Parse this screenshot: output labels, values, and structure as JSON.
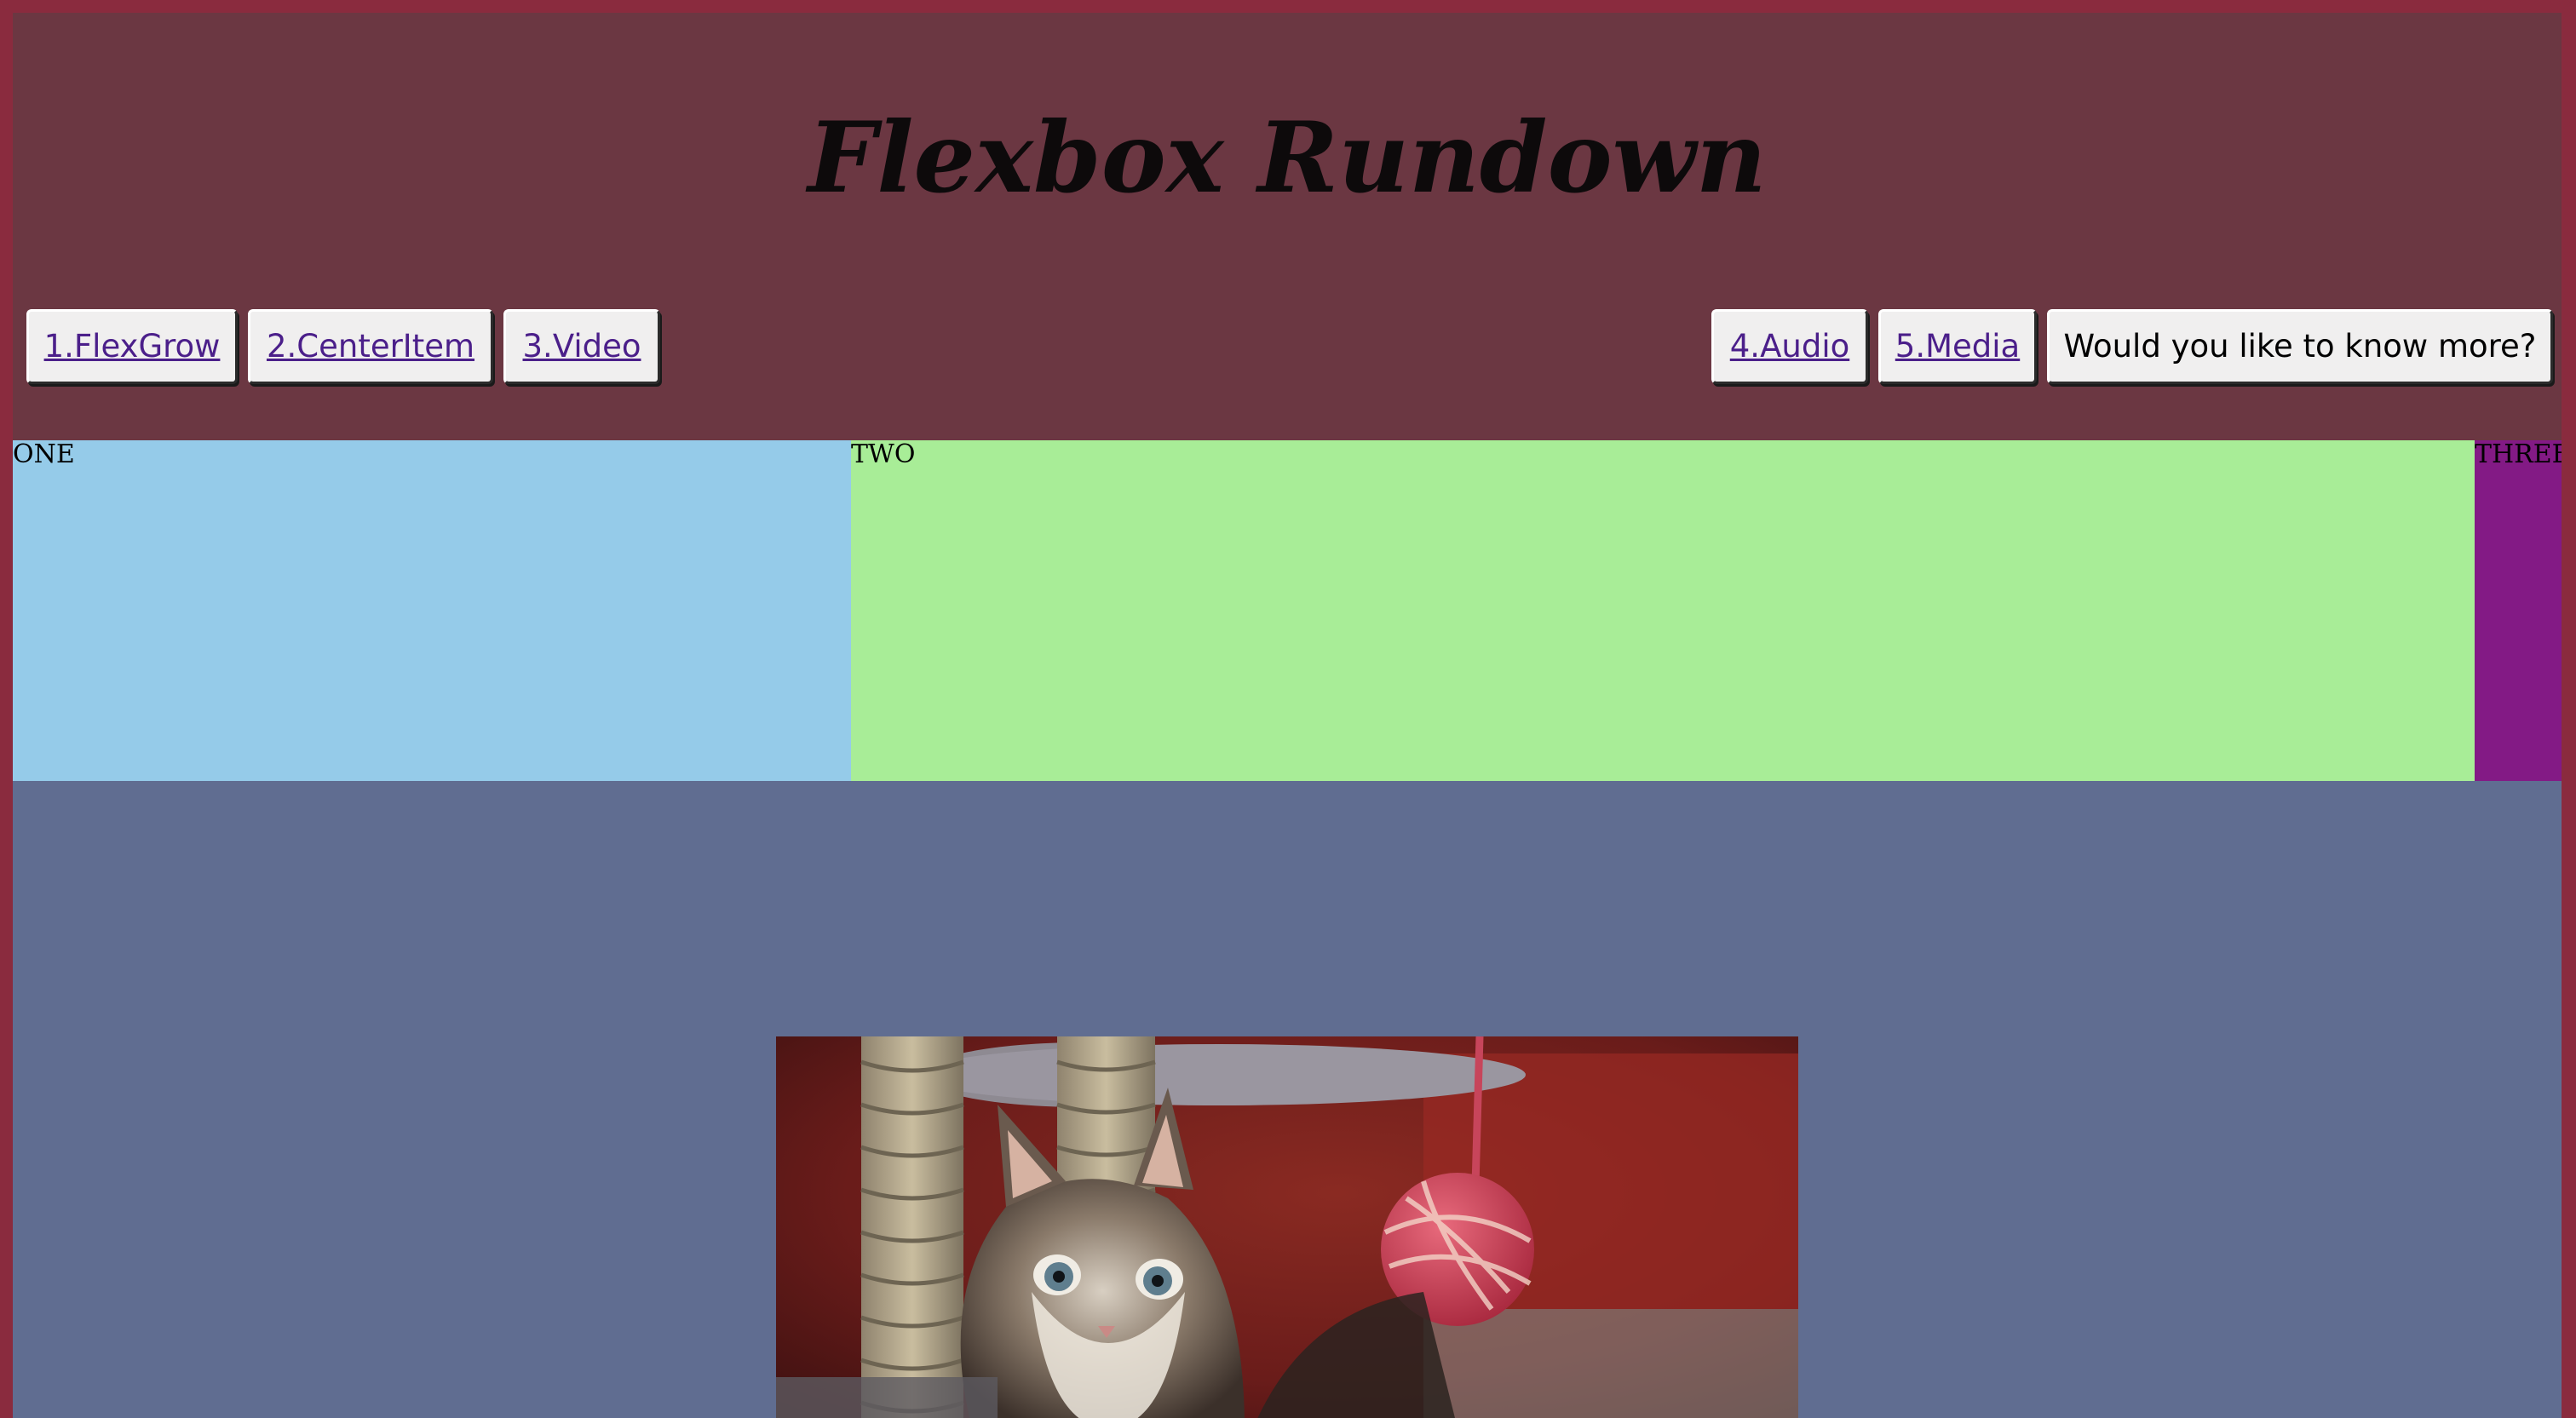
{
  "header": {
    "title": "Flexbox Rundown"
  },
  "nav": {
    "left": [
      {
        "label": "1.FlexGrow"
      },
      {
        "label": "2.CenterItem"
      },
      {
        "label": "3.Video"
      }
    ],
    "right": [
      {
        "label": "4.Audio"
      },
      {
        "label": "5.Media"
      }
    ],
    "more_button": "Would you like to know more?"
  },
  "flex_boxes": {
    "one": "ONE",
    "two": "TWO",
    "three": "THREE"
  },
  "colors": {
    "frame": "#8a2b3e",
    "header_bg": "#6b3742",
    "box_one": "#95cbe9",
    "box_two": "#a8ed97",
    "box_three": "#831a85",
    "section_bg": "#606d91",
    "link": "#4b1f8a"
  },
  "media": {
    "image_subject": "kitten-photo"
  }
}
